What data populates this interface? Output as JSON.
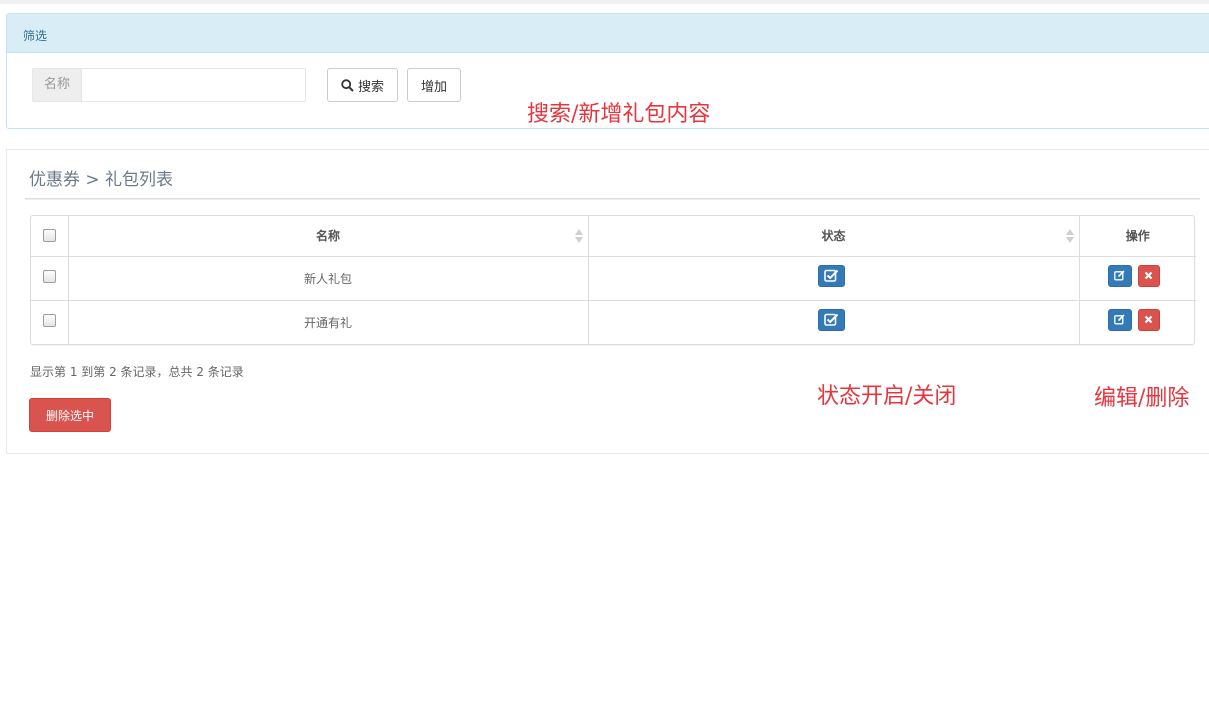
{
  "filter": {
    "heading": "筛选",
    "name_label": "名称",
    "name_value": "",
    "name_placeholder": "",
    "search_label": "搜索",
    "add_label": "增加"
  },
  "list": {
    "breadcrumb": "优惠券 > 礼包列表",
    "columns": [
      "名称",
      "状态",
      "操作"
    ],
    "rows": [
      {
        "name": "新人礼包"
      },
      {
        "name": "开通有礼"
      }
    ],
    "summary": "显示第 1 到第 2 条记录，总共 2 条记录",
    "delete_selected_label": "删除选中"
  },
  "annotations": {
    "search_add": "搜索/新增礼包内容",
    "status_toggle": "状态开启/关闭",
    "edit_delete": "编辑/删除"
  },
  "colors": {
    "primary": "#337ab7",
    "danger": "#d9534f",
    "info_bg": "#d9edf7",
    "annotation": "#e8343c"
  },
  "icons": [
    "search-icon",
    "check-square-icon",
    "edit-icon",
    "close-icon",
    "sort-icon"
  ]
}
